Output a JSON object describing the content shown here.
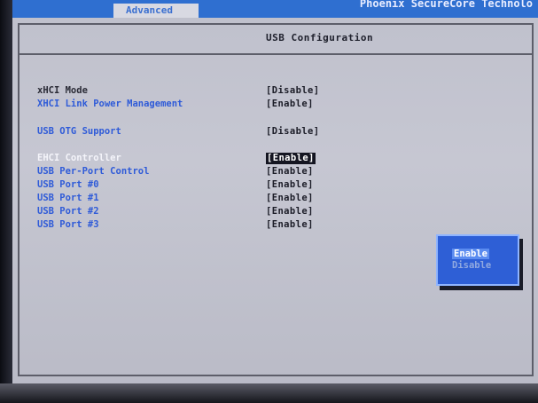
{
  "top_bar": {
    "active_tab": "Advanced",
    "vendor_text": "Phoenix SecureCore Technolo"
  },
  "panel": {
    "title": "USB Configuration"
  },
  "settings": [
    {
      "label": "xHCI Mode",
      "value": "[Disable]"
    },
    {
      "label": "XHCI Link Power Management",
      "value": "[Enable]"
    },
    {
      "label": "USB OTG Support",
      "value": "[Disable]"
    },
    {
      "label": "EHCI Controller",
      "value": "[Enable]"
    },
    {
      "label": "USB Per-Port Control",
      "value": "[Enable]"
    },
    {
      "label": "USB Port #0",
      "value": "[Enable]"
    },
    {
      "label": "USB Port #1",
      "value": "[Enable]"
    },
    {
      "label": "USB Port #2",
      "value": "[Enable]"
    },
    {
      "label": "USB Port #3",
      "value": "[Enable]"
    }
  ],
  "popup": {
    "options": [
      "Enable",
      "Disable"
    ],
    "selected": "Enable"
  },
  "colors": {
    "accent_blue": "#2f6fd0",
    "label_blue": "#2f5bd8",
    "background": "#c3c4cf",
    "popup_bg": "#2e5fd6"
  }
}
